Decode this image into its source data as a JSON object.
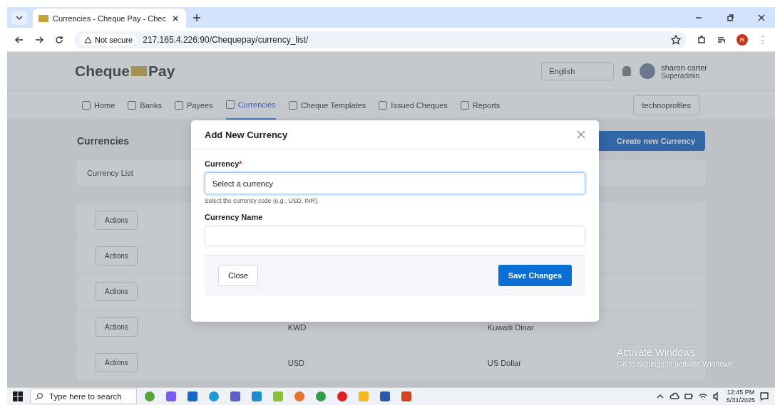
{
  "browser": {
    "tab_title": "Currencies - Cheque Pay - Chec",
    "security": "Not secure",
    "url": "217.165.4.226:90/Chequepay/currency_list/",
    "profile": "R"
  },
  "app": {
    "logo_left": "Cheque",
    "logo_right": "Pay",
    "language": "English",
    "user_name": "sharon carter",
    "user_role": "Superadmin",
    "nav": [
      {
        "label": "Home",
        "selected": false
      },
      {
        "label": "Banks",
        "selected": false
      },
      {
        "label": "Payees",
        "selected": false
      },
      {
        "label": "Currencies",
        "selected": true
      },
      {
        "label": "Cheque Templates",
        "selected": false
      },
      {
        "label": "Issued Cheques",
        "selected": false
      },
      {
        "label": "Reports",
        "selected": false
      }
    ],
    "company": "technoprofiles",
    "page_title": "Currencies",
    "create_button": "Create new Currency",
    "card_title": "Currency List",
    "rows": [
      {
        "actions": "Actions"
      },
      {
        "actions": "Actions"
      },
      {
        "actions": "Actions"
      },
      {
        "actions": "Actions",
        "code": "KWD",
        "name": "Kuwaiti Dinar"
      },
      {
        "actions": "Actions",
        "code": "USD",
        "name": "US Dollar"
      }
    ]
  },
  "modal": {
    "title": "Add New Currency",
    "currency_label": "Currency",
    "required_mark": "*",
    "currency_placeholder": "Select a currency",
    "currency_help": "Select the currency code (e.g., USD, INR).",
    "name_label": "Currency Name",
    "close_button": "Close",
    "save_button": "Save Changes"
  },
  "watermark": {
    "title": "Activate Windows",
    "text": "Go to Settings to activate Windows."
  },
  "taskbar": {
    "search_placeholder": "Type here to search",
    "time": "12:45 PM",
    "date": "5/31/2025"
  }
}
